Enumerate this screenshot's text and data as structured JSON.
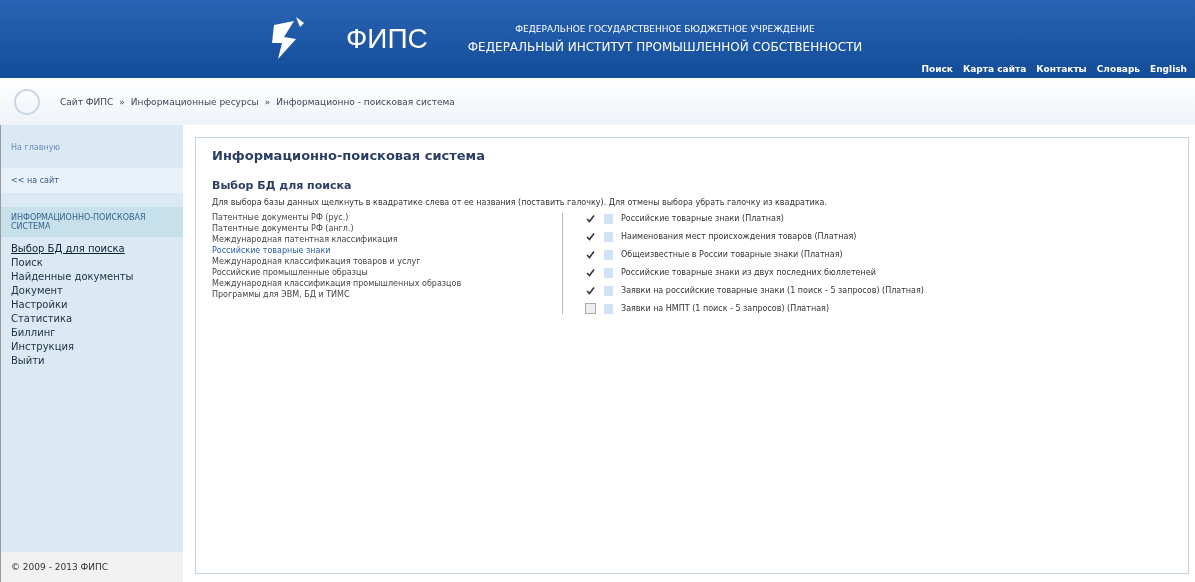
{
  "header": {
    "logo_text": "ФИПС",
    "subtitle": "ФЕДЕРАЛЬНОЕ ГОСУДАРСТВЕННОЕ БЮДЖЕТНОЕ УЧРЕЖДЕНИЕ",
    "title": "ФЕДЕРАЛЬНЫЙ ИНСТИТУТ ПРОМЫШЛЕННОЙ СОБСТВЕННОСТИ",
    "nav": [
      "Поиск",
      "Карта сайта",
      "Контакты",
      "Словарь",
      "English"
    ]
  },
  "breadcrumbs": [
    "Сайт ФИПС",
    "»",
    "Информационные ресурсы",
    "»",
    "Информационно - поисковая система"
  ],
  "sidebar": {
    "home": "На главную",
    "back": "<< на сайт",
    "section": "ИНФОРМАЦИОННО-ПОИСКОВАЯ СИСТЕМА",
    "items": [
      {
        "label": "Выбор БД для поиска",
        "selected": true
      },
      {
        "label": "Поиск",
        "selected": false
      },
      {
        "label": "Найденные документы",
        "selected": false
      },
      {
        "label": "Документ",
        "selected": false
      },
      {
        "label": "Настройки",
        "selected": false
      },
      {
        "label": "Статистика",
        "selected": false
      },
      {
        "label": "Биллинг",
        "selected": false
      },
      {
        "label": "Инструкция",
        "selected": false
      },
      {
        "label": "Выйти",
        "selected": false
      }
    ],
    "footer": "© 2009 - 2013  ФИПС"
  },
  "main": {
    "title": "Информационно-поисковая система",
    "subtitle": "Выбор БД для поиска",
    "instruction": "Для выбора базы данных щелкнуть в квадратике слева от ее названия (поставить галочку). Для отмены выбора убрать галочку из квадратика.",
    "categories": [
      {
        "label": "Патентные документы РФ (рус.)",
        "selected": false
      },
      {
        "label": "Патентные документы РФ (англ.)",
        "selected": false
      },
      {
        "label": "Международная патентная классификация",
        "selected": false
      },
      {
        "label": "Российские товарные знаки",
        "selected": true
      },
      {
        "label": "Международная классификация товаров и услуг",
        "selected": false
      },
      {
        "label": "Российские промышленные образцы",
        "selected": false
      },
      {
        "label": "Международная классификация промышленных образцов",
        "selected": false
      },
      {
        "label": "Программы для ЭВМ, БД и ТИМС",
        "selected": false
      }
    ],
    "databases": [
      {
        "label": "Российские товарные знаки (Платная)",
        "checked": true
      },
      {
        "label": "Наименования мест происхождения товаров (Платная)",
        "checked": true
      },
      {
        "label": "Общеизвестные в России товарные знаки (Платная)",
        "checked": true
      },
      {
        "label": "Российские товарные знаки из двух последних бюллетеней",
        "checked": true
      },
      {
        "label": "Заявки на российские товарные знаки (1 поиск - 5 запросов) (Платная)",
        "checked": true
      },
      {
        "label": "Заявки на НМПТ (1 поиск - 5 запросов) (Платная)",
        "checked": false
      }
    ]
  }
}
